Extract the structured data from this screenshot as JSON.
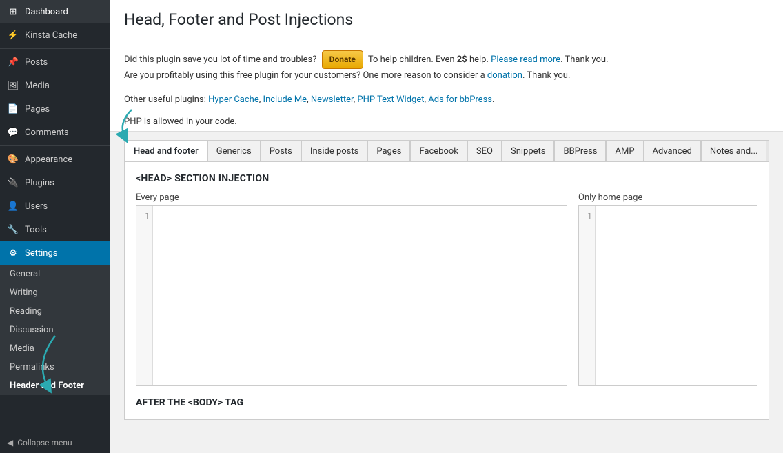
{
  "sidebar": {
    "items": [
      {
        "id": "dashboard",
        "label": "Dashboard",
        "icon": "⊞"
      },
      {
        "id": "kinsta-cache",
        "label": "Kinsta Cache",
        "icon": "⚡"
      },
      {
        "id": "posts",
        "label": "Posts",
        "icon": "📌"
      },
      {
        "id": "media",
        "label": "Media",
        "icon": "🖼"
      },
      {
        "id": "pages",
        "label": "Pages",
        "icon": "📄"
      },
      {
        "id": "comments",
        "label": "Comments",
        "icon": "💬"
      },
      {
        "id": "appearance",
        "label": "Appearance",
        "icon": "🎨"
      },
      {
        "id": "plugins",
        "label": "Plugins",
        "icon": "🔌"
      },
      {
        "id": "users",
        "label": "Users",
        "icon": "👤"
      },
      {
        "id": "tools",
        "label": "Tools",
        "icon": "🔧"
      },
      {
        "id": "settings",
        "label": "Settings",
        "icon": "⚙"
      }
    ],
    "settings_submenu": [
      {
        "id": "general",
        "label": "General"
      },
      {
        "id": "writing",
        "label": "Writing"
      },
      {
        "id": "reading",
        "label": "Reading"
      },
      {
        "id": "discussion",
        "label": "Discussion"
      },
      {
        "id": "media",
        "label": "Media"
      },
      {
        "id": "permalinks",
        "label": "Permalinks"
      },
      {
        "id": "header-footer",
        "label": "Header and Footer",
        "active": true
      }
    ],
    "collapse_label": "Collapse menu"
  },
  "page": {
    "title": "Head, Footer and Post Injections",
    "donate_label": "Donate",
    "notice_line1": "Did this plugin save you lot of time and troubles?",
    "notice_mid": "To help children. Even",
    "notice_bold": "2$",
    "notice_after_bold": "help.",
    "notice_read_more": "Please read more",
    "notice_end": ". Thank you.",
    "notice_line2": "Are you profitably using this free plugin for your customers? One more reason to consider a",
    "notice_donation": "donation",
    "notice_end2": ". Thank you.",
    "plugins_label": "Other useful plugins:",
    "plugins": [
      "Hyper Cache",
      "Include Me",
      "Newsletter",
      "PHP Text Widget",
      "Ads for bbPress"
    ],
    "php_notice": "PHP is allowed in your code."
  },
  "tabs": [
    {
      "id": "head-footer",
      "label": "Head and footer",
      "active": true
    },
    {
      "id": "generics",
      "label": "Generics"
    },
    {
      "id": "posts",
      "label": "Posts"
    },
    {
      "id": "inside-posts",
      "label": "Inside posts"
    },
    {
      "id": "pages",
      "label": "Pages"
    },
    {
      "id": "facebook",
      "label": "Facebook"
    },
    {
      "id": "seo",
      "label": "SEO"
    },
    {
      "id": "snippets",
      "label": "Snippets"
    },
    {
      "id": "bbpress",
      "label": "BBPress"
    },
    {
      "id": "amp",
      "label": "AMP"
    },
    {
      "id": "advanced",
      "label": "Advanced"
    },
    {
      "id": "notes",
      "label": "Notes and..."
    }
  ],
  "head_section": {
    "heading": "<HEAD> SECTION INJECTION",
    "every_page_label": "Every page",
    "only_home_label": "Only home page",
    "line_number": "1",
    "after_body_heading": "AFTER THE <BODY> TAG"
  }
}
